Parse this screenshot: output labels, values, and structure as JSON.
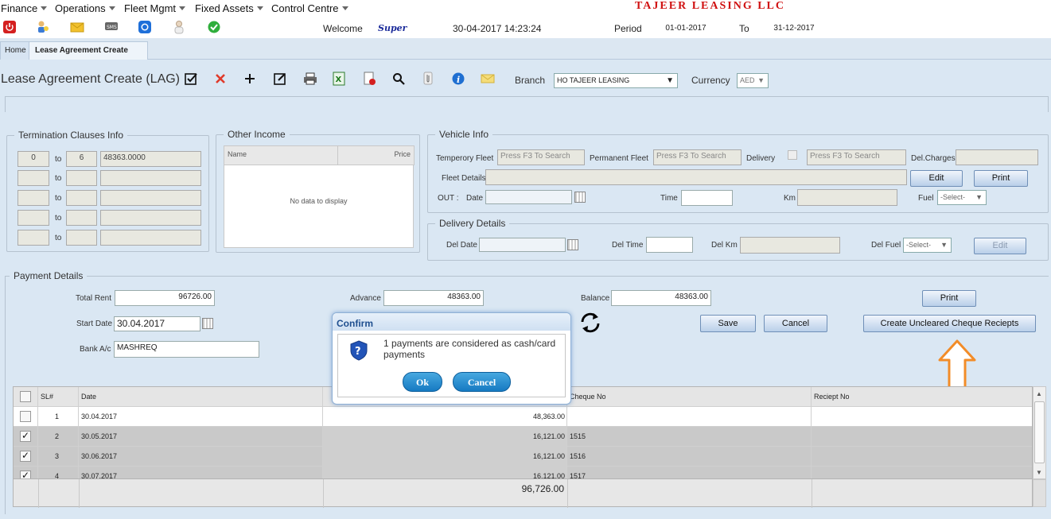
{
  "menu": {
    "items": [
      "Finance",
      "Operations",
      "Fleet Mgmt",
      "Fixed Assets",
      "Control Centre"
    ],
    "company": "TAJEER LEASING LLC"
  },
  "toolbar": {
    "welcome_label": "Welcome",
    "user": "Super",
    "datetime": "30-04-2017 14:23:24",
    "period_label": "Period",
    "period_from": "01-01-2017",
    "to_label": "To",
    "period_to": "31-12-2017",
    "icons": [
      "power-icon",
      "users-icon",
      "mail-icon",
      "sms-icon",
      "chat-icon",
      "user-icon",
      "check-icon"
    ]
  },
  "tabs": [
    {
      "label": "Home",
      "active": false
    },
    {
      "label": "Lease Agreement Create",
      "active": true
    }
  ],
  "page": {
    "title": "Lease Agreement Create (LAG)",
    "branch_label": "Branch",
    "branch_value": "HO TAJEER LEASING",
    "currency_label": "Currency",
    "currency_value": "AED"
  },
  "termination": {
    "legend": "Termination Clauses Info",
    "to_label": "to",
    "rows": [
      {
        "from": "0",
        "to": "6",
        "amount": "48363.0000"
      },
      {
        "from": "",
        "to": "",
        "amount": ""
      },
      {
        "from": "",
        "to": "",
        "amount": ""
      },
      {
        "from": "",
        "to": "",
        "amount": ""
      },
      {
        "from": "",
        "to": "",
        "amount": ""
      }
    ]
  },
  "other_income": {
    "legend": "Other Income",
    "col_name": "Name",
    "col_price": "Price",
    "empty": "No data to display"
  },
  "vehicle": {
    "legend": "Vehicle Info",
    "temp_fleet_label": "Temperory Fleet",
    "temp_fleet_placeholder": "Press F3 To Search",
    "perm_fleet_label": "Permanent Fleet",
    "perm_fleet_placeholder": "Press F3 To Search",
    "delivery_label": "Delivery",
    "delivery_placeholder": "Press F3 To Search",
    "del_charges_label": "Del.Charges",
    "fleet_details_label": "Fleet Details",
    "edit_label": "Edit",
    "print_label": "Print",
    "out_label": "OUT :",
    "date_label": "Date",
    "time_label": "Time",
    "km_label": "Km",
    "fuel_label": "Fuel",
    "fuel_value": "-Select-"
  },
  "delivery": {
    "legend": "Delivery Details",
    "del_date_label": "Del Date",
    "del_time_label": "Del Time",
    "del_km_label": "Del Km",
    "del_fuel_label": "Del Fuel",
    "del_fuel_value": "-Select-",
    "edit_label": "Edit"
  },
  "payment": {
    "legend": "Payment Details",
    "total_rent_label": "Total Rent",
    "total_rent": "96726.00",
    "advance_label": "Advance",
    "advance": "48363.00",
    "balance_label": "Balance",
    "balance": "48363.00",
    "print_label": "Print",
    "start_date_label": "Start Date",
    "start_date": "30.04.2017",
    "save_label": "Save",
    "cancel_label": "Cancel",
    "create_label": "Create Uncleared Cheque Reciepts",
    "bank_label": "Bank A/c",
    "bank_value": "MASHREQ"
  },
  "table": {
    "headers": {
      "sl": "SL#",
      "date": "Date",
      "cheque": "Cheque No",
      "receipt": "Reciept No"
    },
    "rows": [
      {
        "checked": false,
        "sl": "1",
        "date": "30.04.2017",
        "amount": "48,363.00",
        "cheque": "",
        "receipt": ""
      },
      {
        "checked": true,
        "sl": "2",
        "date": "30.05.2017",
        "amount": "16,121.00",
        "cheque": "1515",
        "receipt": ""
      },
      {
        "checked": true,
        "sl": "3",
        "date": "30.06.2017",
        "amount": "16,121.00",
        "cheque": "1516",
        "receipt": ""
      },
      {
        "checked": true,
        "sl": "4",
        "date": "30.07.2017",
        "amount": "16,121.00",
        "cheque": "1517",
        "receipt": ""
      }
    ],
    "total": "96,726.00"
  },
  "confirm": {
    "title": "Confirm",
    "message": "1 payments are considered as cash/card payments",
    "ok_label": "Ok",
    "cancel_label": "Cancel"
  },
  "colors": {
    "company": "#d01010",
    "background": "#dae7f3",
    "annotation_arrow": "#f28c28",
    "dialog_button": "#1c86cf"
  }
}
